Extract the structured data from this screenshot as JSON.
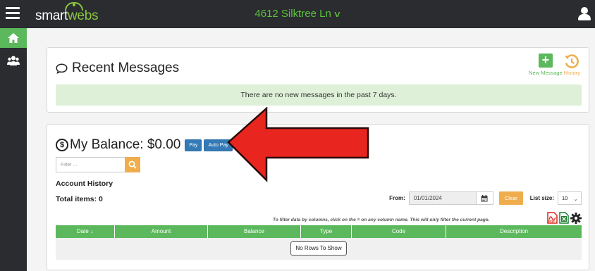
{
  "app": {
    "logo_main": "smart",
    "logo_accent": "webs"
  },
  "header": {
    "address": "4612 Silktree Ln",
    "address_chevron": "∨"
  },
  "sidebar": {
    "items": [
      {
        "icon": "home-icon"
      },
      {
        "icon": "users-icon"
      }
    ]
  },
  "messages": {
    "title": "Recent Messages",
    "notice": "There are no new messages in the past 7 days.",
    "new_message_label": "New Message",
    "history_label": "History"
  },
  "balance": {
    "title": "My Balance: $0.00",
    "pay_label": "Pay",
    "autopay_label": "Auto Pay",
    "filter_placeholder": "Filter ...",
    "account_history": "Account History",
    "total_items": "Total items: 0",
    "from_label": "From:",
    "from_date": "01/01/2024",
    "clear_label": "Clear",
    "list_size_label": "List size:",
    "list_size_value": "10",
    "filter_hint": "To filter data by columns, click on the ≡ on any column name. This will only filter the current page.",
    "columns": [
      "Date",
      "Amount",
      "Balance",
      "Type",
      "Code",
      "Description"
    ],
    "date_sort_indicator": "↓",
    "no_rows": "No Rows To Show"
  },
  "colors": {
    "topbar": "#2a2c30",
    "green": "#5cb85c",
    "orange": "#f0ad4e",
    "blue": "#337ab7",
    "arrow_red": "#e8251f"
  }
}
